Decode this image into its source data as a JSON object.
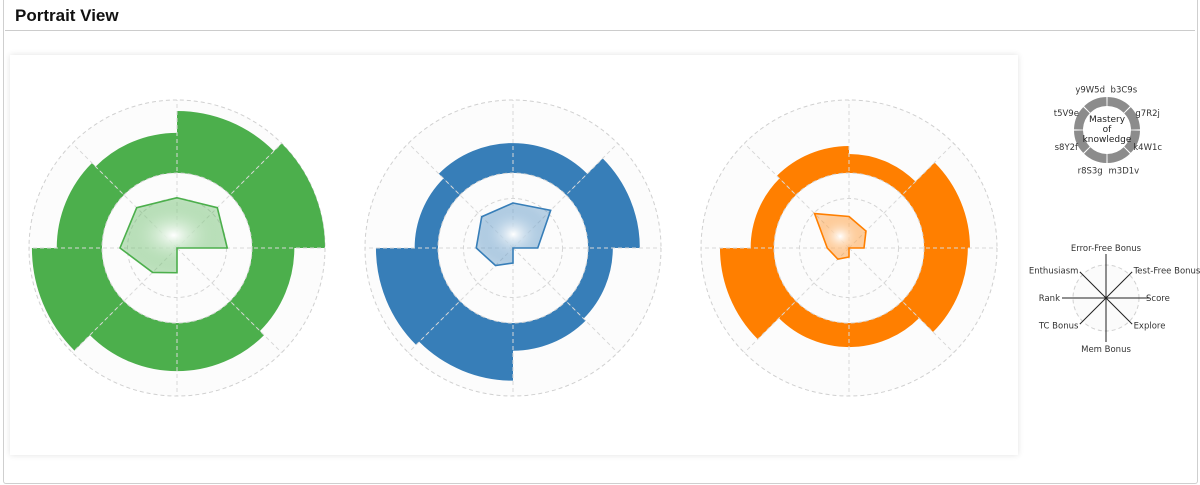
{
  "header": {
    "title": "Portrait View"
  },
  "chart_data": {
    "type": "polar-bar-with-radar",
    "sector_labels": [
      "b3C9s",
      "g7R2j",
      "k4W1c",
      "m3D1v",
      "r8S3g",
      "s8Y2f",
      "t5V9e",
      "y9W5d"
    ],
    "center_label": [
      "Mastery",
      "of",
      "knowledge"
    ],
    "radar_axes": [
      "Error-Free Bonus",
      "Test-Free Bonus",
      "Score",
      "Explore",
      "Mem Bonus",
      "TC Bonus",
      "Rank",
      "Enthusiasm"
    ],
    "value_range": [
      0,
      1
    ],
    "series": [
      {
        "name": "green",
        "color": "#4caf4c",
        "bars": [
          0.85,
          1.0,
          0.58,
          0.66,
          0.66,
          0.96,
          0.62,
          0.55
        ],
        "radar": [
          0.67,
          0.76,
          0.67,
          0.0,
          0.33,
          0.46,
          0.76,
          0.76
        ]
      },
      {
        "name": "blue",
        "color": "#377eb8",
        "bars": [
          0.41,
          0.71,
          0.34,
          0.38,
          0.79,
          0.85,
          0.32,
          0.41
        ],
        "radar": [
          0.6,
          0.71,
          0.33,
          0.0,
          0.2,
          0.33,
          0.49,
          0.59
        ]
      },
      {
        "name": "orange",
        "color": "#ff7f00",
        "bars": [
          0.26,
          0.63,
          0.6,
          0.33,
          0.33,
          0.74,
          0.32,
          0.37
        ],
        "radar": [
          0.42,
          0.32,
          0.2,
          0.0,
          0.12,
          0.21,
          0.29,
          0.65
        ]
      }
    ]
  }
}
